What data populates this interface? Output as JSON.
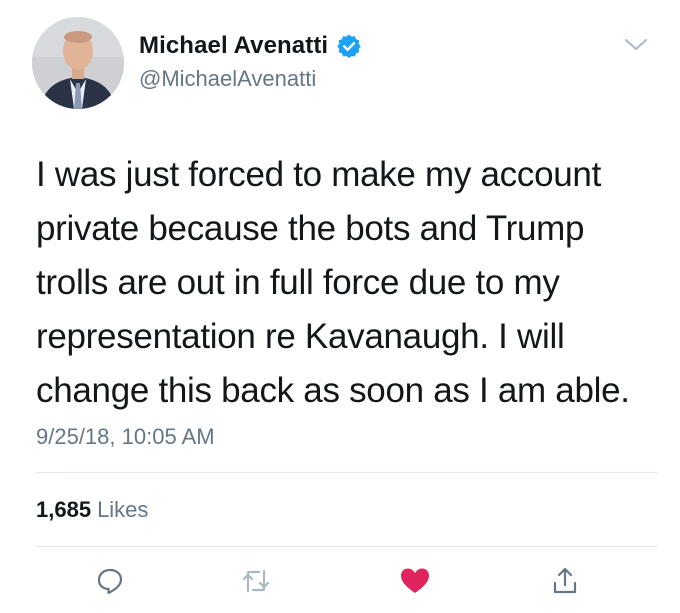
{
  "author": {
    "display_name": "Michael Avenatti",
    "handle": "@MichaelAvenatti",
    "verified": true
  },
  "tweet": {
    "text": "I was just forced to make my account private because the bots and Trump trolls are out in full force due to my representation re Kavanaugh. I will change this back as soon as I am able.",
    "timestamp": "9/25/18, 10:05 AM"
  },
  "stats": {
    "likes_count": "1,685",
    "likes_label": "Likes"
  },
  "actions": {
    "reply_icon": "reply-icon",
    "retweet_icon": "retweet-icon",
    "like_icon": "heart-icon",
    "share_icon": "share-icon"
  },
  "colors": {
    "text": "#14171a",
    "secondary": "#657786",
    "verified": "#1da1f2",
    "like": "#e0245e",
    "divider": "#e1e8ed"
  }
}
